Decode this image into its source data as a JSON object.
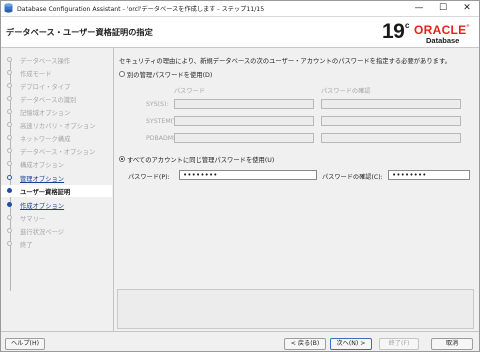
{
  "window": {
    "title": "Database Configuration Assistant - 'orcl'データベースを作成します - ステップ11/15",
    "minimize": "—",
    "maximize": "☐",
    "close": "✕"
  },
  "header": {
    "heading": "データベース・ユーザー資格証明の指定",
    "logo": {
      "version": "19",
      "superscript": "c",
      "brand": "ORACLE",
      "trademark": "®",
      "product": "Database"
    }
  },
  "steps": [
    {
      "label": "データベース操作",
      "state": "done"
    },
    {
      "label": "作成モード",
      "state": "done"
    },
    {
      "label": "デプロイ・タイプ",
      "state": "done"
    },
    {
      "label": "データベースの識別",
      "state": "done"
    },
    {
      "label": "記憶域オプション",
      "state": "done"
    },
    {
      "label": "高速リカバリ・オプション",
      "state": "done"
    },
    {
      "label": "ネットワーク構成",
      "state": "done"
    },
    {
      "label": "データベース・オプション",
      "state": "done"
    },
    {
      "label": "構成オプション",
      "state": "done"
    },
    {
      "label": "管理オプション",
      "state": "link"
    },
    {
      "label": "ユーザー資格証明",
      "state": "active"
    },
    {
      "label": "作成オプション",
      "state": "next"
    },
    {
      "label": "サマリー",
      "state": "pending"
    },
    {
      "label": "進行状況ページ",
      "state": "pending"
    },
    {
      "label": "終了",
      "state": "pending"
    }
  ],
  "main": {
    "intro": "セキュリティの理由により、新規データベースの次のユーザー・アカウントのパスワードを指定する必要があります。",
    "option_separate": {
      "label": "別の管理パスワードを使用(D)",
      "selected": false
    },
    "columns": {
      "password": "パスワード",
      "confirm": "パスワードの確認"
    },
    "accounts": [
      {
        "label": "SYS(S):"
      },
      {
        "label": "SYSTEM(Y):"
      },
      {
        "label": "PDBADMIN:"
      }
    ],
    "option_same": {
      "label": "すべてのアカウントに同じ管理パスワードを使用(U)",
      "selected": true
    },
    "password": {
      "label": "パスワード(P):",
      "value": "••••••••"
    },
    "confirm": {
      "label": "パスワードの確認(C):",
      "value": "••••••••"
    }
  },
  "buttons": {
    "help": "ヘルプ(H)",
    "back": "< 戻る(B)",
    "next": "次へ(N) >",
    "finish": "終了(F)",
    "cancel": "取消"
  }
}
